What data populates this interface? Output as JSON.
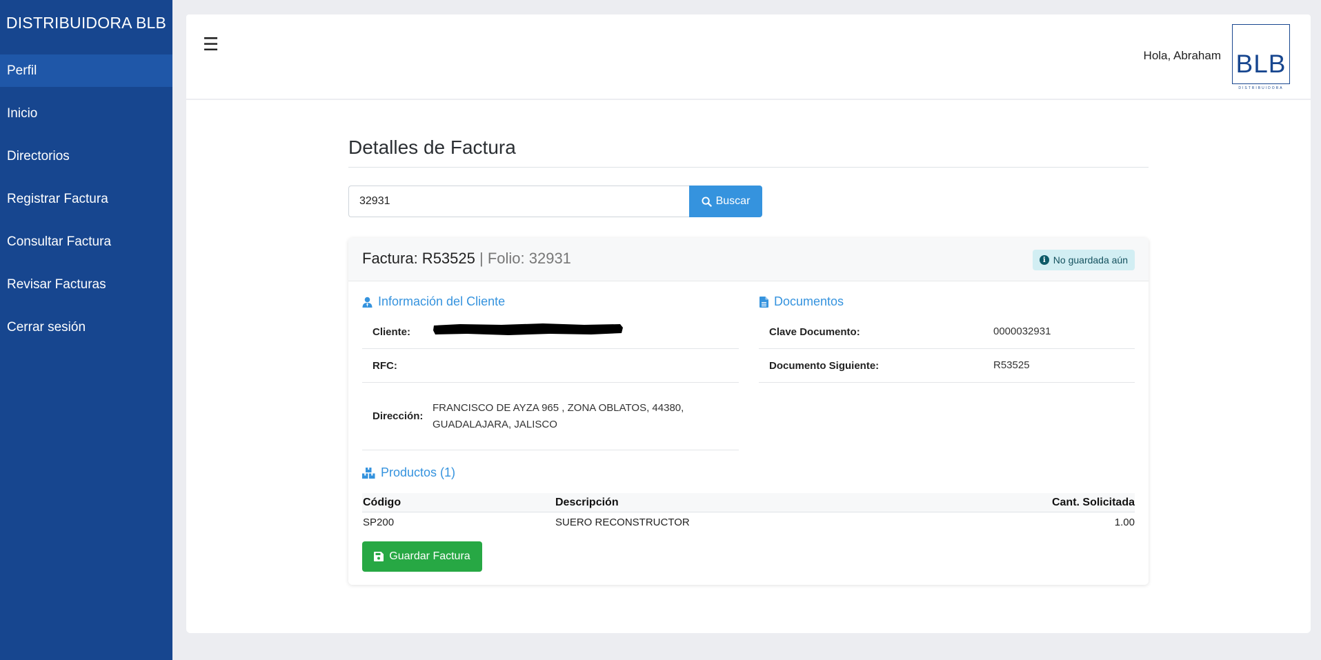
{
  "sidebar": {
    "brand": "DISTRIBUIDORA BLB",
    "items": [
      {
        "label": "Perfil"
      },
      {
        "label": "Inicio"
      },
      {
        "label": "Directorios"
      },
      {
        "label": "Registrar Factura"
      },
      {
        "label": "Consultar Factura"
      },
      {
        "label": "Revisar Facturas"
      },
      {
        "label": "Cerrar sesión"
      }
    ],
    "active": "Perfil"
  },
  "header": {
    "menu_icon": "☰",
    "greeting": "Hola, Abraham",
    "logo_text": "BLB",
    "logo_subtext": "DISTRIBUIDORA"
  },
  "page": {
    "title": "Detalles de Factura",
    "search": {
      "value": "32931",
      "button_label": "Buscar"
    }
  },
  "invoice": {
    "factura_label": "Factura: R53525",
    "separator": " | ",
    "folio_label": "Folio: 32931",
    "status": "No guardada aún",
    "client_section": {
      "title": "Información del Cliente",
      "rows": [
        {
          "key": "Cliente:",
          "value": ""
        },
        {
          "key": "RFC:",
          "value": ""
        },
        {
          "key": "Dirección:",
          "value": "FRANCISCO DE AYZA 965 , ZONA OBLATOS, 44380, GUADALAJARA, JALISCO"
        }
      ]
    },
    "documents_section": {
      "title": "Documentos",
      "rows": [
        {
          "key": "Clave Documento:",
          "value": "0000032931"
        },
        {
          "key": "Documento Siguiente:",
          "value": "R53525"
        }
      ]
    },
    "products_section": {
      "title": "Productos (1)",
      "columns": [
        "Código",
        "Descripción",
        "Cant. Solicitada"
      ],
      "rows": [
        {
          "codigo": "SP200",
          "descripcion": "SUERO RECONSTRUCTOR",
          "cantidad": "1.00"
        }
      ]
    },
    "save_button": "Guardar Factura"
  },
  "colors": {
    "sidebar": "#17468f",
    "accent": "#3593de",
    "success": "#27a844",
    "badge_bg": "#d2eef3"
  }
}
